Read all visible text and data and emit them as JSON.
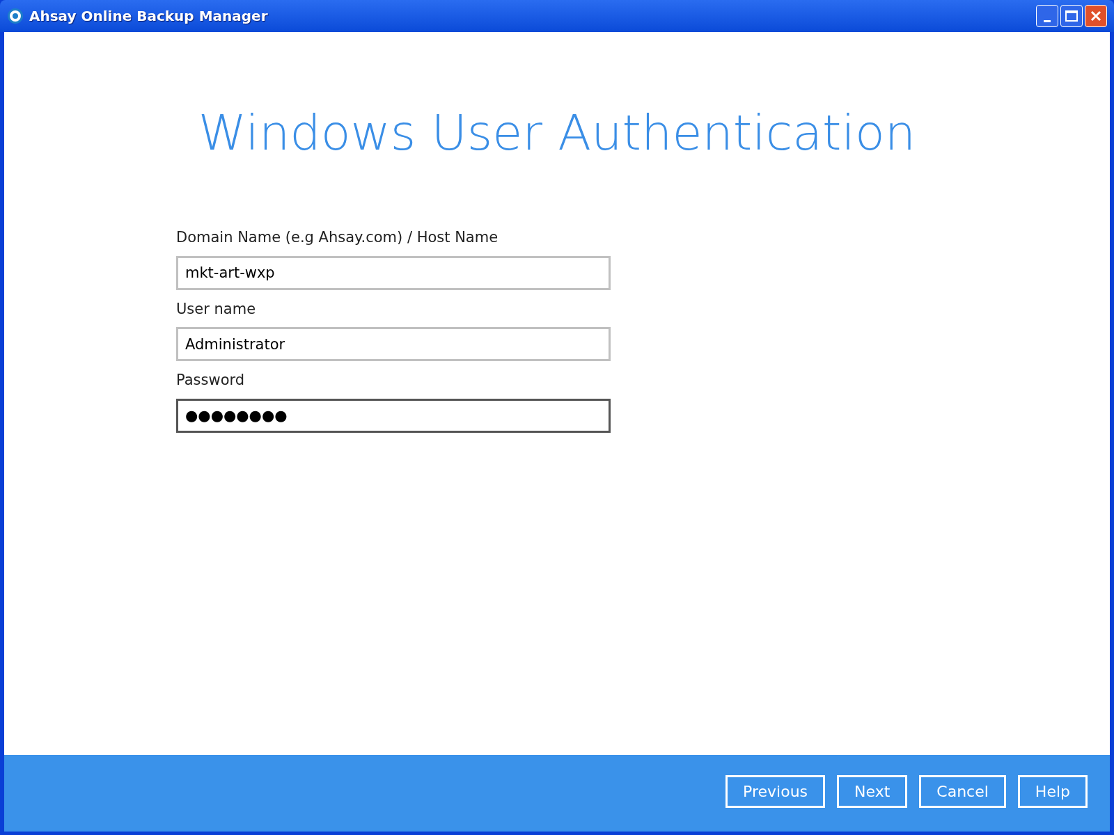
{
  "window": {
    "title": "Ahsay Online Backup Manager"
  },
  "heading": "Windows User Authentication",
  "fields": [
    {
      "label": "Domain Name (e.g Ahsay.com) / Host Name",
      "value": "mkt-art-wxp",
      "focused": false
    },
    {
      "label": "User name",
      "value": "Administrator",
      "focused": false
    },
    {
      "label": "Password",
      "value": "●●●●●●●●",
      "focused": true
    }
  ],
  "buttons": [
    "Previous",
    "Next",
    "Cancel",
    "Help"
  ]
}
